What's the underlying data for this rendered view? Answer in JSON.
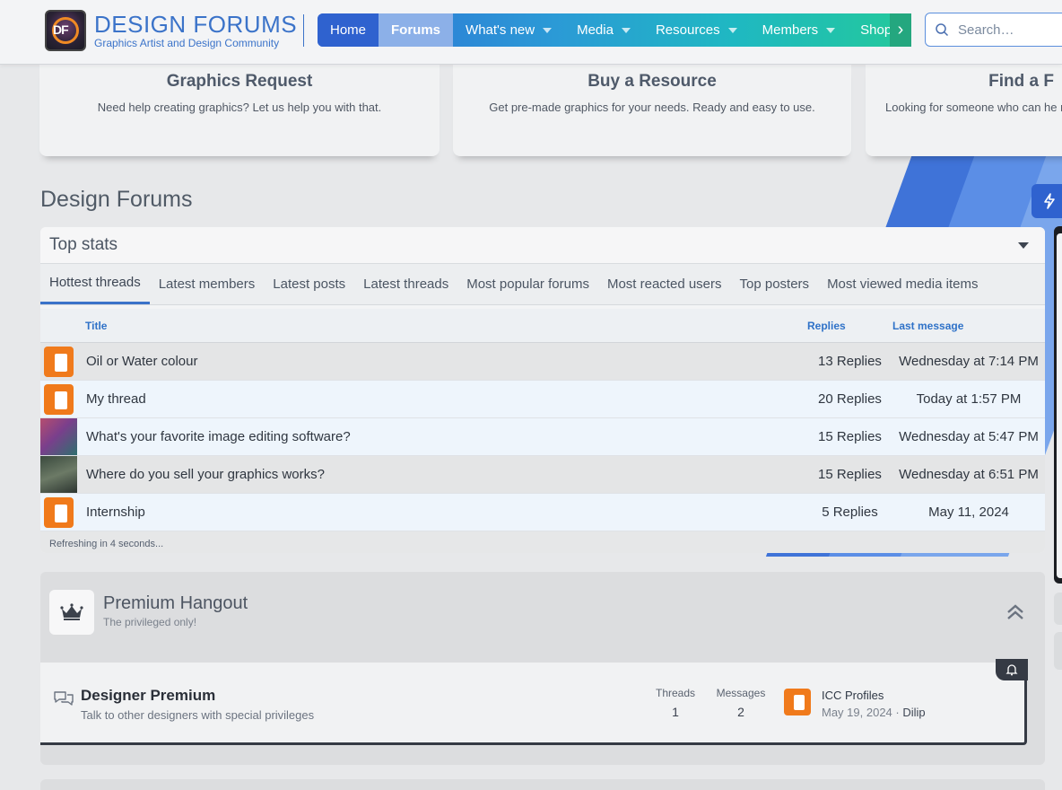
{
  "brand": {
    "title": "DESIGN FORUMS",
    "subtitle": "Graphics Artist and Design Community",
    "logo_letters": "DF"
  },
  "nav": {
    "items": [
      {
        "label": "Home",
        "has_caret": false
      },
      {
        "label": "Forums",
        "has_caret": false
      },
      {
        "label": "What's new",
        "has_caret": true
      },
      {
        "label": "Media",
        "has_caret": true
      },
      {
        "label": "Resources",
        "has_caret": true
      },
      {
        "label": "Members",
        "has_caret": true
      },
      {
        "label": "Shop",
        "has_caret": false
      }
    ],
    "active": "Forums"
  },
  "search": {
    "placeholder": "Search…"
  },
  "cards": [
    {
      "title": "Graphics Request",
      "desc": "Need help creating graphics? Let us help you with that."
    },
    {
      "title": "Buy a Resource",
      "desc": "Get pre-made graphics for your needs. Ready and easy to use."
    },
    {
      "title": "Find a F",
      "desc": "Looking for someone who can he righ"
    }
  ],
  "page_title": "Design Forums",
  "top_stats": {
    "heading": "Top stats",
    "tabs": [
      "Hottest threads",
      "Latest members",
      "Latest posts",
      "Latest threads",
      "Most popular forums",
      "Most reacted users",
      "Top posters",
      "Most viewed media items"
    ],
    "active_tab": "Hottest threads",
    "columns": {
      "title": "Title",
      "replies": "Replies",
      "last": "Last message"
    },
    "rows": [
      {
        "title": "Oil or Water colour",
        "replies": "13 Replies",
        "last": "Wednesday at 7:14 PM",
        "avatar": "logo"
      },
      {
        "title": "My thread",
        "replies": "20 Replies",
        "last": "Today at 1:57 PM",
        "avatar": "logo"
      },
      {
        "title": "What's your favorite image editing software?",
        "replies": "15 Replies",
        "last": "Wednesday at 5:47 PM",
        "avatar": "photo1"
      },
      {
        "title": "Where do you sell your graphics works?",
        "replies": "15 Replies",
        "last": "Wednesday at 6:51 PM",
        "avatar": "photo2"
      },
      {
        "title": "Internship",
        "replies": "5 Replies",
        "last": "May 11, 2024",
        "avatar": "logo"
      }
    ],
    "refresh_text": "Refreshing in 4 seconds..."
  },
  "premium": {
    "title": "Premium Hangout",
    "subtitle": "The privileged only!",
    "forum": {
      "name": "Designer Premium",
      "desc": "Talk to other designers with special privileges",
      "threads_label": "Threads",
      "threads": "1",
      "messages_label": "Messages",
      "messages": "2",
      "last_title": "ICC Profiles",
      "last_date": "May 19, 2024",
      "last_sep": " · ",
      "last_user": "Dilip"
    }
  },
  "colors": {
    "accent": "#3b73c9",
    "nav_home": "#2f62cf",
    "orange": "#f07a1b"
  }
}
